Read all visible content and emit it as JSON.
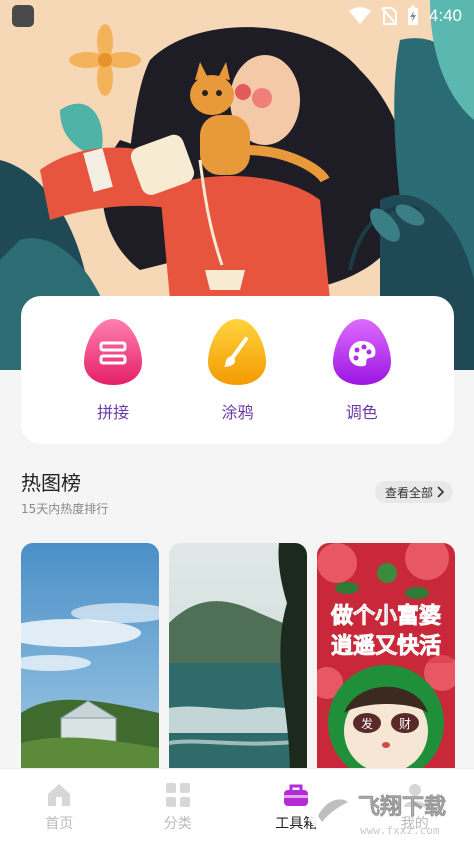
{
  "status_bar": {
    "time": "4:40"
  },
  "tools": [
    {
      "label": "拼接",
      "icon": "stitch-icon",
      "color_top": "#ff6fa5",
      "color_bottom": "#e6246b"
    },
    {
      "label": "涂鸦",
      "icon": "brush-icon",
      "color_top": "#ffd23a",
      "color_bottom": "#f5a100"
    },
    {
      "label": "调色",
      "icon": "palette-icon",
      "color_top": "#d45cff",
      "color_bottom": "#a01fe0"
    }
  ],
  "section": {
    "title": "热图榜",
    "subtitle": "15天内热度排行",
    "view_all": "查看全部"
  },
  "cards": [
    {
      "name": "sky-greenhouse-image"
    },
    {
      "name": "sea-mountain-image"
    },
    {
      "name": "floral-cartoon-image",
      "text_line1": "做个小富婆",
      "text_line2": "逍遥又快活",
      "glasses_left": "发",
      "glasses_right": "财"
    }
  ],
  "nav": [
    {
      "label": "首页",
      "icon": "home-icon"
    },
    {
      "label": "分类",
      "icon": "grid-icon"
    },
    {
      "label": "工具箱",
      "icon": "toolbox-icon",
      "active": true
    },
    {
      "label": "我的",
      "icon": "profile-icon"
    }
  ],
  "watermark": {
    "brand": "飞翔下载",
    "url": "www.fxxz.com"
  },
  "colors": {
    "accent_purple": "#6b3aa8",
    "toolbox_active": "#b42bd6"
  }
}
